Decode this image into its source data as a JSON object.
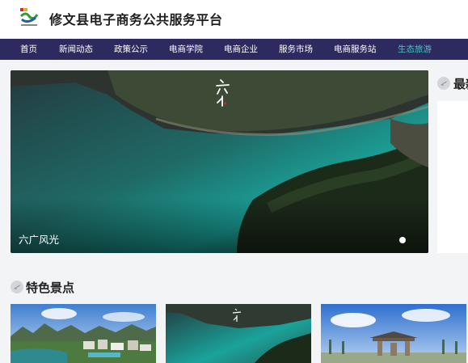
{
  "header": {
    "title": "修文县电子商务公共服务平台",
    "logo_icon": "platform-logo-icon"
  },
  "nav": {
    "items": [
      {
        "label": "首页",
        "active": false
      },
      {
        "label": "新闻动态",
        "active": false
      },
      {
        "label": "政策公示",
        "active": false
      },
      {
        "label": "电商学院",
        "active": false
      },
      {
        "label": "电商企业",
        "active": false
      },
      {
        "label": "服务市场",
        "active": false
      },
      {
        "label": "电商服务站",
        "active": false
      },
      {
        "label": "生态旅游",
        "active": true
      }
    ],
    "active_color": "#46c8c2",
    "bg_color": "#2c2a5e"
  },
  "banner": {
    "caption": "六广风光",
    "calligraphy": "六广",
    "slide_count": 1,
    "active_slide": 1
  },
  "side_panel": {
    "title": "最新"
  },
  "featured": {
    "title": "特色景点",
    "icon": "plane-icon"
  }
}
